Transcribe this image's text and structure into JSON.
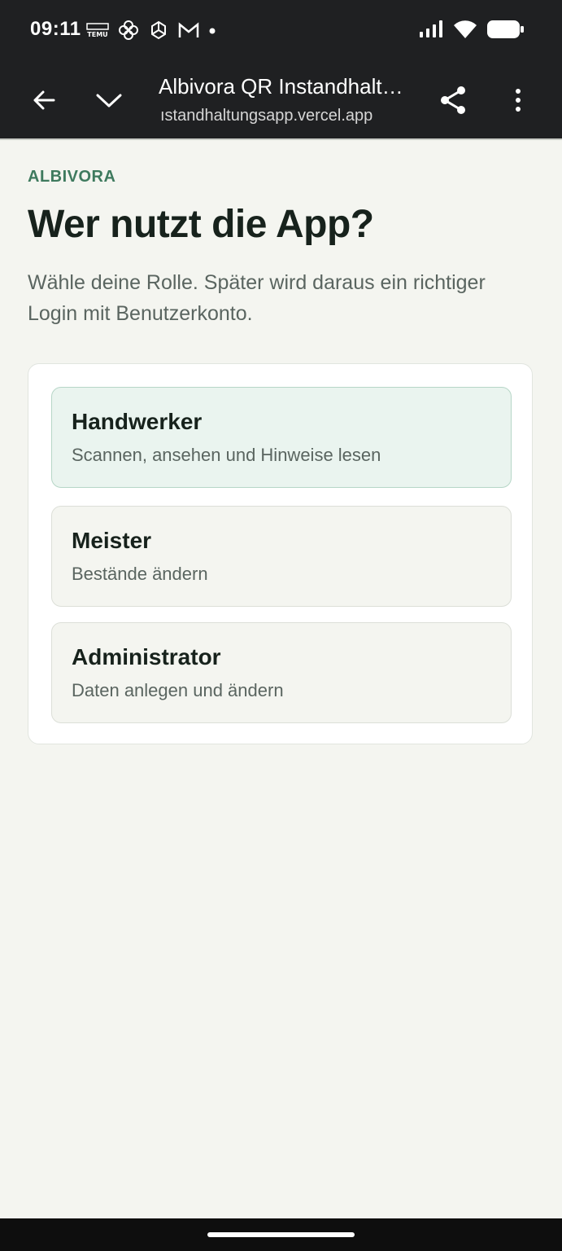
{
  "status_bar": {
    "time": "09:11",
    "notification_icons": [
      "temu-icon",
      "pinwheel-app-icon",
      "chatgpt-icon",
      "gmail-icon",
      "dot-icon"
    ],
    "system_icons": [
      "signal-icon",
      "wifi-icon",
      "battery-icon"
    ]
  },
  "browser": {
    "title": "Albivora QR Instandhalt…",
    "url": "ıstandhaltungsapp.vercel.app",
    "buttons": [
      "back-arrow-icon",
      "chevron-down-icon",
      "share-icon",
      "more-vert-icon"
    ]
  },
  "page": {
    "brand": "ALBIVORA",
    "headline": "Wer nutzt die App?",
    "intro": "Wähle deine Rolle. Später wird daraus ein richtiger Login mit Benutzerkonto."
  },
  "roles": [
    {
      "title": "Handwerker",
      "description": "Scannen, ansehen und Hinweise lesen",
      "selected": true
    },
    {
      "title": "Meister",
      "description": "Bestände ändern",
      "selected": false
    },
    {
      "title": "Administrator",
      "description": "Daten anlegen und ändern",
      "selected": false
    }
  ],
  "colors": {
    "accent": "#3e7a5e",
    "selected_bg": "#eaf4ef",
    "page_bg": "#f4f5f0",
    "chrome_bg": "#1f2022"
  }
}
